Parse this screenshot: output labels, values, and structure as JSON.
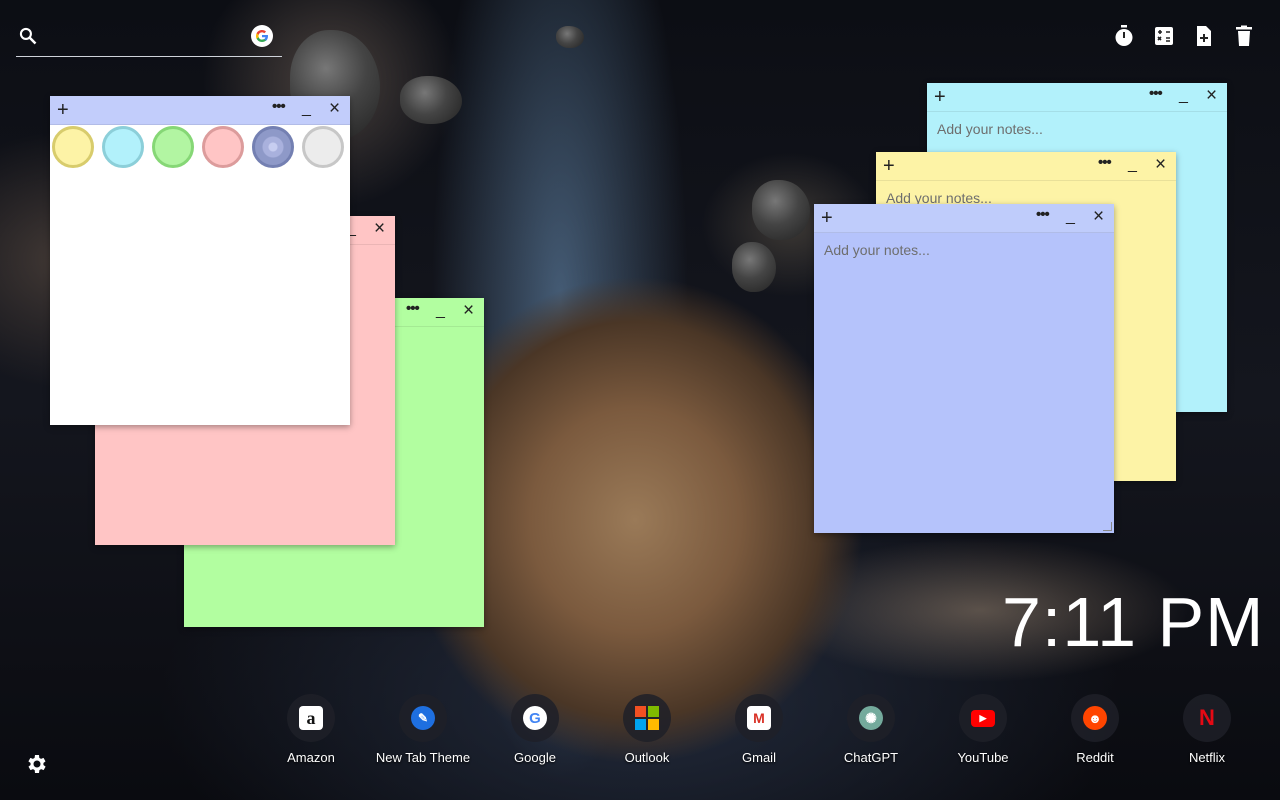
{
  "search": {
    "placeholder": ""
  },
  "toolbar": {
    "timer": "timer-icon",
    "calculator": "calculator-icon",
    "new_note": "add-note-icon",
    "delete": "trash-icon"
  },
  "notes": {
    "plus": "+",
    "more": "•••",
    "minimize": "_",
    "close": "×",
    "placeholder": "Add your notes...",
    "palette": [
      {
        "name": "yellow",
        "fill": "#fdf3a6",
        "ring": "#d8cc6c"
      },
      {
        "name": "cyan",
        "fill": "#b2f1fb",
        "ring": "#8ccfd9"
      },
      {
        "name": "green",
        "fill": "#b2f5a2",
        "ring": "#86d776"
      },
      {
        "name": "pink",
        "fill": "#ffc5c5",
        "ring": "#dc9c9c"
      },
      {
        "name": "blue",
        "fill": "#8e99c8",
        "ring": "#7480b2"
      },
      {
        "name": "white",
        "fill": "#ececec",
        "ring": "#c7c7c7"
      }
    ],
    "colors": {
      "white": "#ffffff",
      "pink": "#ffc5c5",
      "green": "#b2fea0",
      "cyan": "#b2f1fb",
      "yellow": "#fdf3a6",
      "blue": "#b5c3fb",
      "blue_bar": "#c2cdfb"
    }
  },
  "clock": {
    "time": "7:11 PM"
  },
  "shortcuts": [
    {
      "label": "Amazon",
      "icon": "amazon-icon"
    },
    {
      "label": "New Tab Theme",
      "icon": "new-tab-theme-icon"
    },
    {
      "label": "Google",
      "icon": "google-icon"
    },
    {
      "label": "Outlook",
      "icon": "outlook-icon"
    },
    {
      "label": "Gmail",
      "icon": "gmail-icon"
    },
    {
      "label": "ChatGPT",
      "icon": "chatgpt-icon"
    },
    {
      "label": "YouTube",
      "icon": "youtube-icon"
    },
    {
      "label": "Reddit",
      "icon": "reddit-icon"
    },
    {
      "label": "Netflix",
      "icon": "netflix-icon"
    }
  ],
  "settings": {
    "icon": "gear-icon"
  }
}
